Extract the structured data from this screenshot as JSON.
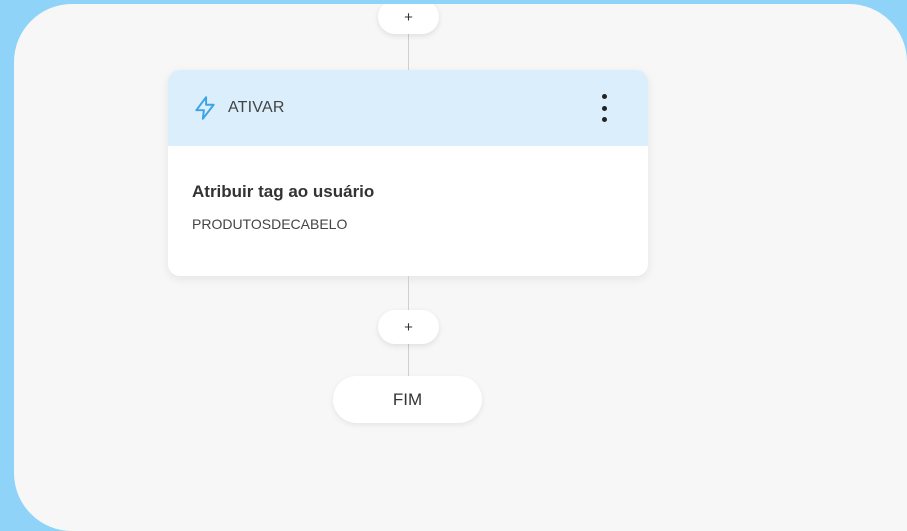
{
  "flow": {
    "add_step_top": "+",
    "add_step_bottom": "+",
    "end_label": "FIM"
  },
  "action_card": {
    "type_label": "ATIVAR",
    "icon": "lightning-bolt-icon",
    "title": "Atribuir tag ao usuário",
    "value": "PRODUTOSDECABELO",
    "header_color": "#daeefb",
    "icon_color": "#3ba3e6"
  },
  "colors": {
    "outer_background": "#8fd4f8",
    "canvas_background": "#f7f7f7"
  }
}
